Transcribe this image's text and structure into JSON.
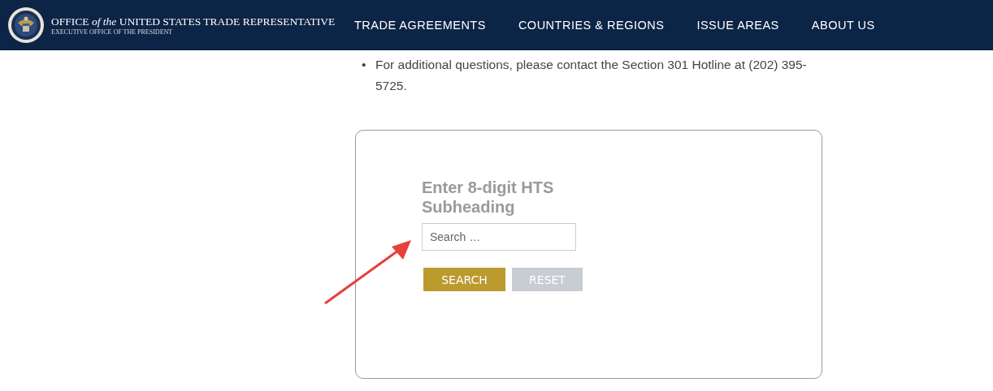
{
  "header": {
    "title": "OFFICE *of the* UNITED STATES TRADE REPRESENTATIVE",
    "subtitle": "EXECUTIVE OFFICE OF THE PRESIDENT",
    "nav": [
      {
        "label": "TRADE AGREEMENTS"
      },
      {
        "label": "COUNTRIES & REGIONS"
      },
      {
        "label": "ISSUE AREAS"
      },
      {
        "label": "ABOUT US"
      }
    ]
  },
  "bullets": [
    {
      "marker": "•",
      "text": "For additional questions, please contact the Section 301 Hotline at (202) 395-5725."
    }
  ],
  "search_box": {
    "label": "Enter 8-digit HTS Subheading",
    "placeholder": "Search …",
    "buttons": [
      {
        "label": "SEARCH",
        "kind": "primary"
      },
      {
        "label": "RESET",
        "kind": "secondary"
      }
    ]
  }
}
